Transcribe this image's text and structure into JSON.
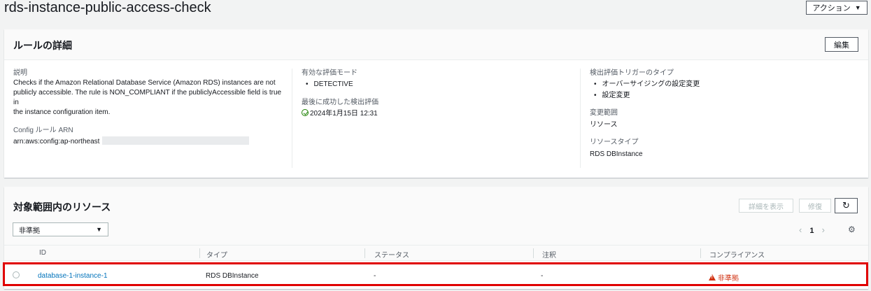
{
  "header": {
    "title": "rds-instance-public-access-check",
    "actions_label": "アクション"
  },
  "rule_details": {
    "title": "ルールの詳細",
    "edit_label": "編集",
    "description_label": "説明",
    "description_lines": [
      "Checks if the Amazon Relational Database Service (Amazon RDS) instances are not",
      "publicly accessible. The rule is NON_COMPLIANT if the publiclyAccessible field is true in",
      "the instance configuration item."
    ],
    "arn_label": "Config ルール ARN",
    "arn_value": "arn:aws:config:ap-northeast",
    "eval_mode_label": "有効な評価モード",
    "eval_mode_value": "DETECTIVE",
    "last_success_label": "最後に成功した検出評価",
    "last_success_value": "2024年1月15日 12:31",
    "trigger_label": "検出評価トリガーのタイプ",
    "triggers": [
      "オーバーサイジングの設定変更",
      "設定変更"
    ],
    "scope_label": "変更範囲",
    "scope_value": "リソース",
    "resource_type_label": "リソースタイプ",
    "resource_type_value": "RDS DBInstance"
  },
  "resources": {
    "title": "対象範囲内のリソース",
    "view_details_label": "詳細を表示",
    "remediate_label": "修復",
    "filter_value": "非準拠",
    "page_number": "1",
    "columns": [
      "ID",
      "タイプ",
      "ステータス",
      "注釈",
      "コンプライアンス"
    ],
    "rows": [
      {
        "id": "database-1-instance-1",
        "type": "RDS DBInstance",
        "status": "-",
        "annotation": "-",
        "compliance": "非準拠"
      }
    ]
  },
  "colors": {
    "link": "#0073bb",
    "noncompliant": "#d13212",
    "success": "#1d8102",
    "highlight": "#e00000"
  }
}
